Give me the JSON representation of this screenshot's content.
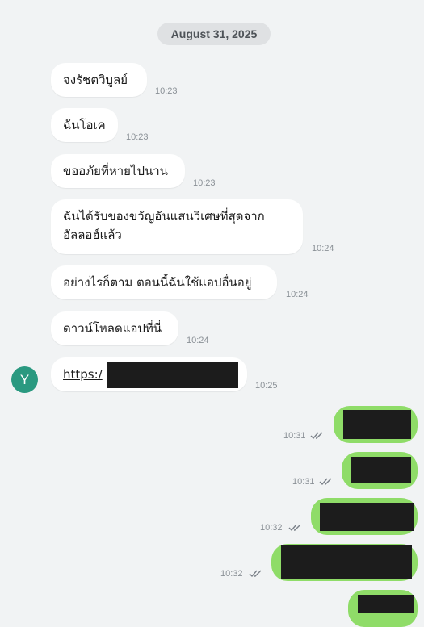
{
  "date_separator": "August 31, 2025",
  "colors": {
    "outgoing_bubble": "#8fdc68",
    "incoming_bubble": "#ffffff",
    "avatar": "#2a9980",
    "background": "#f1f3f4"
  },
  "sender_avatar": {
    "initial": "Y"
  },
  "incoming": [
    {
      "text": "จงรัชตวิบูลย์",
      "time": "10:23"
    },
    {
      "text": "ฉันโอเค",
      "time": "10:23"
    },
    {
      "text": "ขออภัยที่หายไปนาน",
      "time": "10:23"
    },
    {
      "line1": "ฉันได้รับของขวัญอันแสนวิเศษที่สุดจาก",
      "line2": "อัลลอฮ์แล้ว",
      "time": "10:24"
    },
    {
      "text": "อย่างไรก็ตาม ตอนนี้ฉันใช้แอปอื่นอยู่",
      "time": "10:24"
    },
    {
      "text": "ดาวน์โหลดแอปที่นี่",
      "time": "10:24"
    },
    {
      "text": "https:/",
      "time": "10:25"
    }
  ],
  "outgoing": [
    {
      "time": "10:31",
      "status_icon": "double-check-icon"
    },
    {
      "time": "10:31",
      "status_icon": "double-check-icon"
    },
    {
      "time": "10:32",
      "status_icon": "double-check-icon"
    },
    {
      "time": "10:32",
      "status_icon": "double-check-icon"
    },
    {
      "time": "",
      "status_icon": ""
    }
  ]
}
